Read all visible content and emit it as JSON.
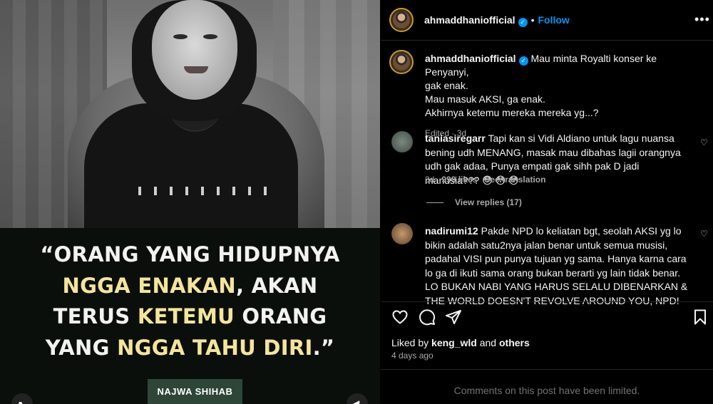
{
  "post": {
    "quote_lines": [
      [
        {
          "t": "“ORANG YANG HIDUPNYA",
          "hl": false
        }
      ],
      [
        {
          "t": "NGGA ENAKAN",
          "hl": true
        },
        {
          "t": ", AKAN",
          "hl": false
        }
      ],
      [
        {
          "t": "TERUS ",
          "hl": false
        },
        {
          "t": "KETEMU",
          "hl": true
        },
        {
          "t": " ORANG",
          "hl": false
        }
      ],
      [
        {
          "t": "YANG ",
          "hl": false
        },
        {
          "t": "NGGA TAHU DIRI",
          "hl": true
        },
        {
          "t": ".”",
          "hl": false
        }
      ]
    ],
    "credit": "NAJWA SHIHAB",
    "colors": {
      "highlight": "#f5e59a",
      "credit_bg": "#2d4638"
    }
  },
  "header": {
    "username": "ahmaddhaniofficial",
    "verified_icon": "verified-badge-icon",
    "separator": "•",
    "follow_label": "Follow",
    "more_icon": "more-options-icon"
  },
  "caption": {
    "username": "ahmaddhaniofficial",
    "lines": [
      "Mau minta Royalti konser ke Penyanyi,",
      "gak enak.",
      "Mau masuk AKSI, ga enak.",
      "Akhirnya ketemu mereka mereka yg...?"
    ],
    "meta": "Edited · 3d"
  },
  "comments": [
    {
      "username": "taniasiregarr",
      "text": "Tapi kan si Vidi Aldiano untuk lagu nuansa bening udh MENANG, masak mau dibahas lagii orangnya udh gak adaa, Punya empati gak sihh pak D jadi manusia??? 😳 😳 😳",
      "age": "3d",
      "likes": "999 likes",
      "translate": "See translation",
      "view_replies": "View replies (17)"
    },
    {
      "username": "nadirumi12",
      "text": "Pakde NPD lo keliatan bgt, seolah AKSI yg lo bikin adalah satu2nya jalan benar untuk semua musisi, padahal VISI pun punya tujuan yg sama. Hanya karna cara lo ga di ikuti sama orang bukan berarti yg lain tidak benar. LO BUKAN NABI YANG HARUS SELALU DIBENARKAN & THE WORLD DOESN'T REVOLVE AROUND YOU, NPD!"
    }
  ],
  "actions": {
    "like_icon": "heart-icon",
    "comment_icon": "comment-icon",
    "share_icon": "share-icon",
    "save_icon": "bookmark-icon"
  },
  "likes": {
    "prefix": "Liked by",
    "user": "keng_wld",
    "joiner": "and",
    "others": "others"
  },
  "post_date": "4 days ago",
  "comments_limited": "Comments on this post have been limited."
}
